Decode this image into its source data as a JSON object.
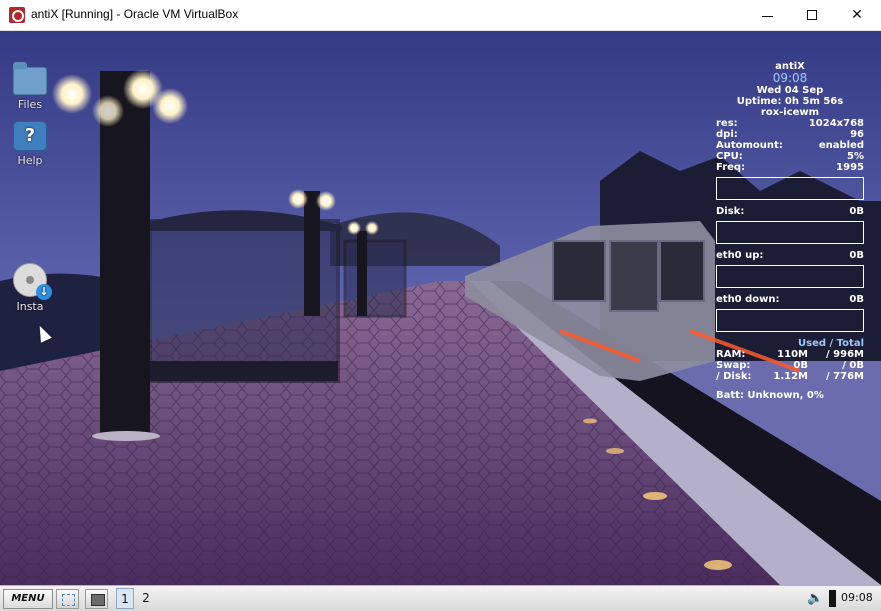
{
  "window": {
    "title": "antiX [Running] - Oracle VM VirtualBox",
    "icon": "virtualbox-icon",
    "controls": {
      "minimize": "minimize-icon",
      "maximize": "maximize-icon",
      "close": "close-icon",
      "close_glyph": "✕"
    }
  },
  "desktop_icons": [
    {
      "label": "Files",
      "icon": "folder-icon"
    },
    {
      "label": "Help",
      "icon": "help-icon",
      "glyph": "?"
    },
    {
      "label": "Insta",
      "icon": "install-icon",
      "badge": "↓"
    }
  ],
  "conky": {
    "hostname": "antiX",
    "time": "09:08",
    "date": "Wed 04 Sep",
    "uptime": "Uptime: 0h 5m 56s",
    "wm": "rox-icewm",
    "stats": [
      {
        "label": "res:",
        "value": "1024x768"
      },
      {
        "label": "dpi:",
        "value": "96"
      },
      {
        "label": "Automount:",
        "value": "enabled"
      },
      {
        "label": "CPU:",
        "value": "5%"
      },
      {
        "label": "Freq:",
        "value": "1995"
      }
    ],
    "disk": {
      "label": "Disk:",
      "value": "0B"
    },
    "eth_up": {
      "label": "eth0 up:",
      "value": "0B"
    },
    "eth_down": {
      "label": "eth0 down:",
      "value": "0B"
    },
    "mem_header": "Used / Total",
    "mem": [
      {
        "label": "RAM:",
        "used": "110M",
        "total": "/ 996M"
      },
      {
        "label": "Swap:",
        "used": "0B",
        "total": "/ 0B"
      },
      {
        "label": "/ Disk:",
        "used": "1.12M",
        "total": "/ 776M"
      }
    ],
    "battery": "Batt: Unknown, 0%"
  },
  "taskbar": {
    "menu_label": "MENU",
    "workspaces": [
      "1",
      "2"
    ],
    "active_workspace": "1",
    "volume_glyph": "🔈",
    "clock": "09:08"
  },
  "colors": {
    "sky_top": "#3a3d86",
    "conky_accent": "#9fc8ff",
    "platform": "#7a5a8a"
  }
}
